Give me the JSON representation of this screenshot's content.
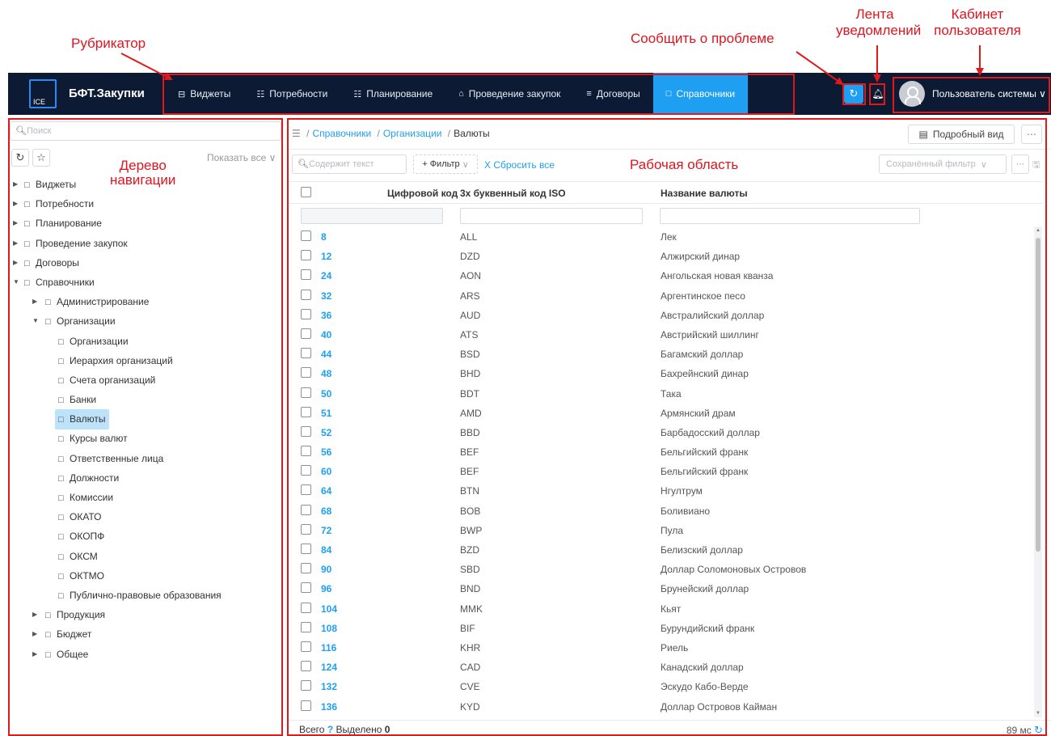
{
  "annotations": {
    "rubricator": "Рубрикатор",
    "report_problem": "Сообщить о проблеме",
    "notifications_line1": "Лента",
    "notifications_line2": "уведомлений",
    "cabinet_line1": "Кабинет",
    "cabinet_line2": "пользователя",
    "nav_tree_line1": "Дерево",
    "nav_tree_line2": "навигации",
    "work_area": "Рабочая область"
  },
  "header": {
    "logo_text": "ICE",
    "brand": "БФТ.Закупки",
    "menu": [
      {
        "label": "Виджеты",
        "icon": "widget-icon"
      },
      {
        "label": "Потребности",
        "icon": "needs-icon"
      },
      {
        "label": "Планирование",
        "icon": "calendar-icon"
      },
      {
        "label": "Проведение закупок",
        "icon": "cart-icon"
      },
      {
        "label": "Договоры",
        "icon": "contract-icon"
      },
      {
        "label": "Справочники",
        "icon": "book-icon",
        "active": true
      }
    ],
    "user_name": "Пользователь системы"
  },
  "sidebar": {
    "search_placeholder": "Поиск",
    "show_all": "Показать все",
    "tree": [
      {
        "label": "Виджеты",
        "level": 0
      },
      {
        "label": "Потребности",
        "level": 0
      },
      {
        "label": "Планирование",
        "level": 0
      },
      {
        "label": "Проведение закупок",
        "level": 0
      },
      {
        "label": "Договоры",
        "level": 0
      },
      {
        "label": "Справочники",
        "level": 0,
        "expanded": true
      },
      {
        "label": "Администрирование",
        "level": 1
      },
      {
        "label": "Организации",
        "level": 1,
        "expanded": true
      },
      {
        "label": "Организации",
        "level": 2
      },
      {
        "label": "Иерархия организаций",
        "level": 2
      },
      {
        "label": "Счета организаций",
        "level": 2
      },
      {
        "label": "Банки",
        "level": 2
      },
      {
        "label": "Валюты",
        "level": 2,
        "selected": true
      },
      {
        "label": "Курсы валют",
        "level": 2
      },
      {
        "label": "Ответственные лица",
        "level": 2
      },
      {
        "label": "Должности",
        "level": 2
      },
      {
        "label": "Комиссии",
        "level": 2
      },
      {
        "label": "ОКАТО",
        "level": 2
      },
      {
        "label": "ОКОПФ",
        "level": 2
      },
      {
        "label": "ОКСМ",
        "level": 2
      },
      {
        "label": "ОКТМО",
        "level": 2
      },
      {
        "label": "Публично-правовые образования",
        "level": 2
      },
      {
        "label": "Продукция",
        "level": 1
      },
      {
        "label": "Бюджет",
        "level": 1
      },
      {
        "label": "Общее",
        "level": 1
      }
    ]
  },
  "workspace": {
    "breadcrumb": [
      "Справочники",
      "Организации",
      "Валюты"
    ],
    "detail_view": "Подробный вид",
    "text_search_placeholder": "Содержит текст",
    "add_filter": "+ Фильтр",
    "reset_all": "X Сбросить все",
    "saved_filter": "Сохранённый фильтр",
    "columns": [
      "Цифровой код",
      "3х буквенный код ISO",
      "Название валюты"
    ],
    "rows": [
      {
        "code": "8",
        "iso": "ALL",
        "name": "Лек"
      },
      {
        "code": "12",
        "iso": "DZD",
        "name": "Алжирский динар"
      },
      {
        "code": "24",
        "iso": "AON",
        "name": "Ангольская новая кванза"
      },
      {
        "code": "32",
        "iso": "ARS",
        "name": "Аргентинское песо"
      },
      {
        "code": "36",
        "iso": "AUD",
        "name": "Австралийский доллар"
      },
      {
        "code": "40",
        "iso": "ATS",
        "name": "Австрийский шиллинг"
      },
      {
        "code": "44",
        "iso": "BSD",
        "name": "Багамский доллар"
      },
      {
        "code": "48",
        "iso": "BHD",
        "name": "Бахрейнский динар"
      },
      {
        "code": "50",
        "iso": "BDT",
        "name": "Така"
      },
      {
        "code": "51",
        "iso": "AMD",
        "name": "Армянский драм"
      },
      {
        "code": "52",
        "iso": "BBD",
        "name": "Барбадосский доллар"
      },
      {
        "code": "56",
        "iso": "BEF",
        "name": "Бельгийский франк"
      },
      {
        "code": "60",
        "iso": "BEF",
        "name": "Бельгийский франк"
      },
      {
        "code": "64",
        "iso": "BTN",
        "name": "Нгултрум"
      },
      {
        "code": "68",
        "iso": "BOB",
        "name": "Боливиано"
      },
      {
        "code": "72",
        "iso": "BWP",
        "name": "Пула"
      },
      {
        "code": "84",
        "iso": "BZD",
        "name": "Белизский доллар"
      },
      {
        "code": "90",
        "iso": "SBD",
        "name": "Доллар Соломоновых Островов"
      },
      {
        "code": "96",
        "iso": "BND",
        "name": "Брунейский доллар"
      },
      {
        "code": "104",
        "iso": "MMK",
        "name": "Кьят"
      },
      {
        "code": "108",
        "iso": "BIF",
        "name": "Бурундийский франк"
      },
      {
        "code": "116",
        "iso": "KHR",
        "name": "Риель"
      },
      {
        "code": "124",
        "iso": "CAD",
        "name": "Канадский доллар"
      },
      {
        "code": "132",
        "iso": "CVE",
        "name": "Эскудо Кабо-Верде"
      },
      {
        "code": "136",
        "iso": "KYD",
        "name": "Доллар Островов Кайман"
      }
    ],
    "footer_total": "Всего",
    "footer_total_value": "?",
    "footer_selected": "Выделено",
    "footer_selected_value": "0",
    "footer_time": "89 мс"
  },
  "colors": {
    "topbar": "#0c1a33",
    "accent": "#1e9ff2",
    "annotation": "#e0141e",
    "selected_node": "#bde3fb"
  }
}
